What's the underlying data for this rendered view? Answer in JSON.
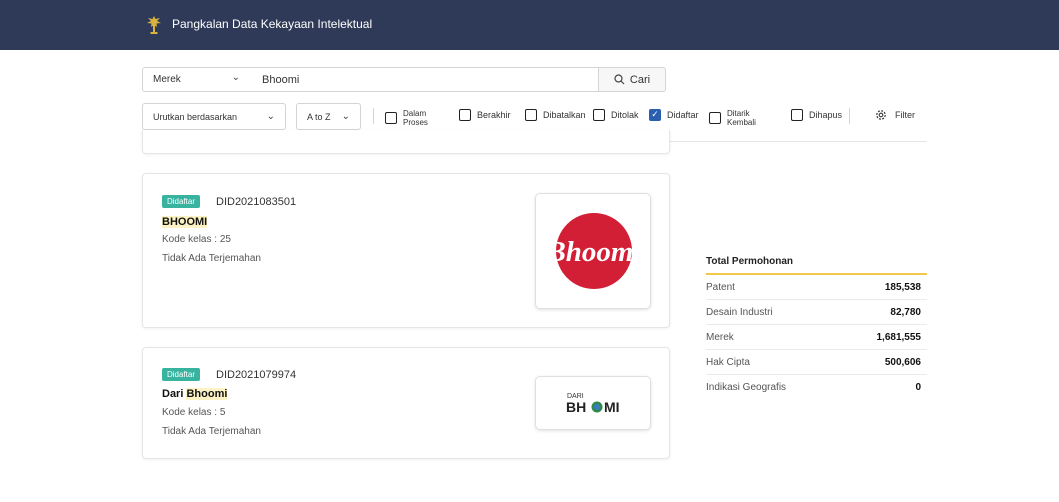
{
  "header": {
    "app_title": "Pangkalan Data Kekayaan Intelektual",
    "bg_color": "#2f3a58"
  },
  "search": {
    "type_value": "Merek",
    "query": "Bhoomi",
    "button_label": "Cari"
  },
  "filters": {
    "sort_label": "Urutkan berdasarkan",
    "order_label": "A to Z",
    "checkboxes": [
      {
        "line1": "Dalam",
        "line2": "Proses",
        "checked": false
      },
      {
        "label": "Berakhir",
        "checked": false
      },
      {
        "label": "Dibatalkan",
        "checked": false
      },
      {
        "label": "Ditolak",
        "checked": false
      },
      {
        "label": "Didaftar",
        "checked": true
      },
      {
        "line1": "Ditarik",
        "line2": "Kembali",
        "checked": false
      },
      {
        "label": "Dihapus",
        "checked": false
      }
    ],
    "filter_label": "Filter"
  },
  "results": [
    {
      "status": "Didaftar",
      "app_no": "DID2021083501",
      "brand": "BHOOMI",
      "class_label": "Kode kelas : 25",
      "translation": "Tidak Ada Terjemahan",
      "logo_text": "Bhoomi"
    },
    {
      "status": "Didaftar",
      "app_no": "DID2021079974",
      "brand_prefix": "Dari ",
      "brand": "Bhoomi",
      "class_label": "Kode kelas : 5",
      "translation": "Tidak Ada Terjemahan",
      "logo_small": "DARI",
      "logo_main_a": "BH",
      "logo_main_b": "MI"
    }
  ],
  "stats": {
    "title": "Total Permohonan",
    "rows": [
      {
        "label": "Patent",
        "value": "185,538"
      },
      {
        "label": "Desain Industri",
        "value": "82,780"
      },
      {
        "label": "Merek",
        "value": "1,681,555"
      },
      {
        "label": "Hak Cipta",
        "value": "500,606"
      },
      {
        "label": "Indikasi Geografis",
        "value": "0"
      }
    ]
  }
}
